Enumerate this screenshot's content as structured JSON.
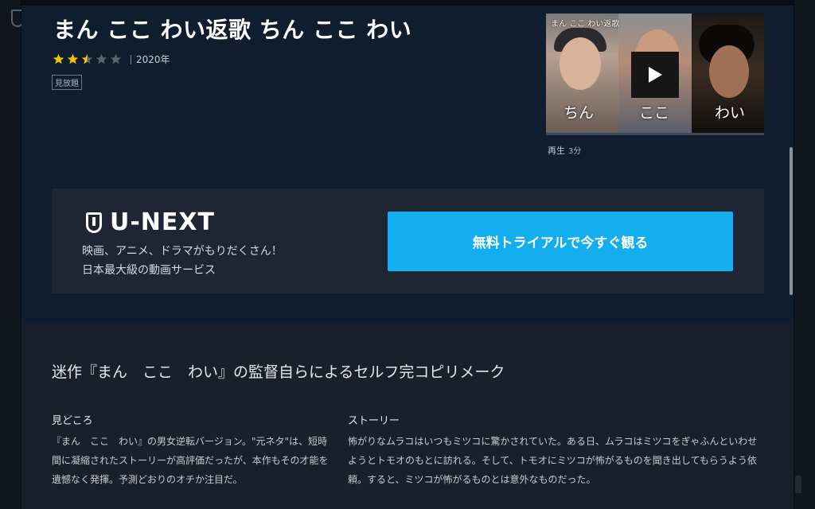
{
  "title": "まん ここ わい返歌 ちん ここ わい",
  "rating": {
    "value": 2.5,
    "max": 5,
    "year": "2020年"
  },
  "badge": "見放題",
  "colors": {
    "background": "#0f1d2f",
    "accent": "#12aef0",
    "star": "#f2c200",
    "star_empty": "#5b636d"
  },
  "trailer": {
    "caption": "まん ここ わい返歌",
    "panels": [
      "ちん",
      "ここ",
      "わい"
    ],
    "play_label": "再生",
    "duration": "3分"
  },
  "promo": {
    "brand": "U-NEXT",
    "lines": [
      "映画、アニメ、ドラマがもりだくさん！",
      "日本最大級の動画サービス"
    ],
    "cta_label": "無料トライアルで今すぐ観る"
  },
  "catchphrase": "迷作『まん　ここ　わい』の監督自らによるセルフ完コピリメーク",
  "highlights": {
    "heading": "見どころ",
    "body": "『まん　ここ　わい』の男女逆転バージョン。\"元ネタ\"は、短時間に凝縮されたストーリーが高評価だったが、本作もその才能を遺憾なく発揮。予測どおりのオチか注目だ。"
  },
  "story": {
    "heading": "ストーリー",
    "body": "怖がりなムラコはいつもミツコに驚かされていた。ある日、ムラコはミツコをぎゃふんといわせようとトモオのもとに訪れる。そして、トモオにミツコが怖がるものを聞き出してもらうよう依頼。すると、ミツコが怖がるものとは意外なものだった。"
  }
}
